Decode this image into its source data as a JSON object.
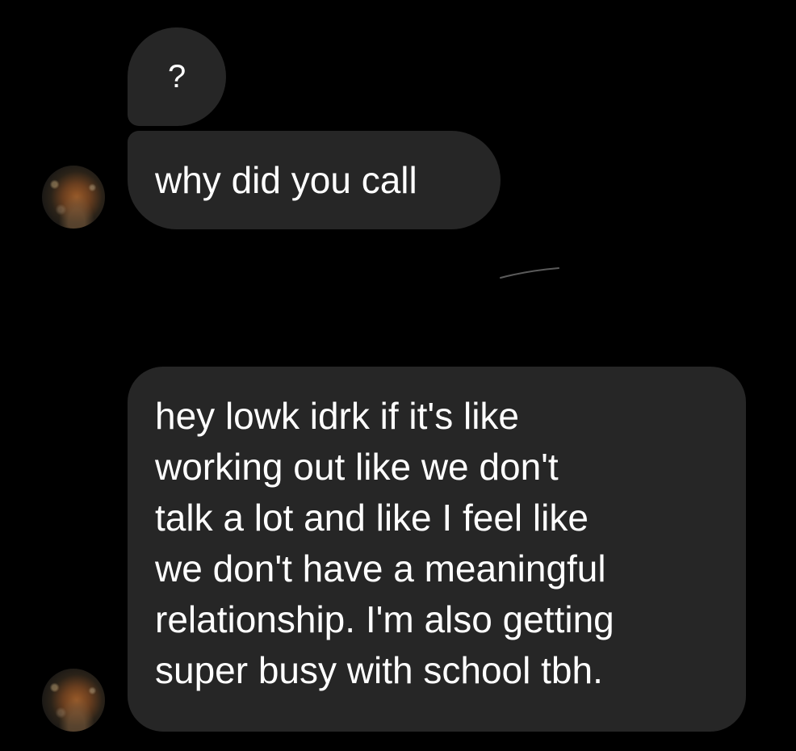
{
  "messages": [
    {
      "sender": "other",
      "text": "?"
    },
    {
      "sender": "other",
      "text": "why did you call"
    },
    {
      "sender": "other",
      "text": "hey lowk idrk if it's like\nworking out like we don't\ntalk a lot and like I feel like\nwe don't have a meaningful\nrelationship. I'm also getting\nsuper busy with school tbh."
    }
  ],
  "colors": {
    "background": "#000000",
    "bubble": "#262626",
    "text": "#ffffff"
  }
}
